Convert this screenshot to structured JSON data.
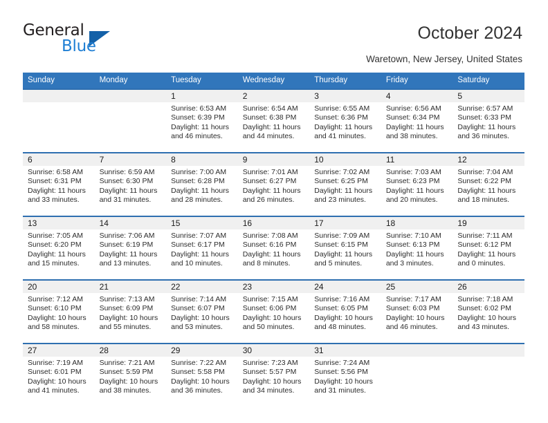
{
  "brand": {
    "name_part1": "General",
    "name_part2": "Blue",
    "accent_color": "#1f7fd4",
    "triangle_color": "#1461a8",
    "logo_icon": "triangle-logo-icon"
  },
  "header": {
    "title": "October 2024",
    "subtitle": "Waretown, New Jersey, United States"
  },
  "calendar": {
    "header_color": "#3176bb",
    "band_color": "#f0f0f0",
    "separator_color": "#2e6fb0",
    "weekday_headers": [
      "Sunday",
      "Monday",
      "Tuesday",
      "Wednesday",
      "Thursday",
      "Friday",
      "Saturday"
    ],
    "weeks": [
      [
        {
          "day": "",
          "sunrise": "",
          "sunset": "",
          "daylight_line1": "",
          "daylight_line2": ""
        },
        {
          "day": "",
          "sunrise": "",
          "sunset": "",
          "daylight_line1": "",
          "daylight_line2": ""
        },
        {
          "day": "1",
          "sunrise": "Sunrise: 6:53 AM",
          "sunset": "Sunset: 6:39 PM",
          "daylight_line1": "Daylight: 11 hours",
          "daylight_line2": "and 46 minutes."
        },
        {
          "day": "2",
          "sunrise": "Sunrise: 6:54 AM",
          "sunset": "Sunset: 6:38 PM",
          "daylight_line1": "Daylight: 11 hours",
          "daylight_line2": "and 44 minutes."
        },
        {
          "day": "3",
          "sunrise": "Sunrise: 6:55 AM",
          "sunset": "Sunset: 6:36 PM",
          "daylight_line1": "Daylight: 11 hours",
          "daylight_line2": "and 41 minutes."
        },
        {
          "day": "4",
          "sunrise": "Sunrise: 6:56 AM",
          "sunset": "Sunset: 6:34 PM",
          "daylight_line1": "Daylight: 11 hours",
          "daylight_line2": "and 38 minutes."
        },
        {
          "day": "5",
          "sunrise": "Sunrise: 6:57 AM",
          "sunset": "Sunset: 6:33 PM",
          "daylight_line1": "Daylight: 11 hours",
          "daylight_line2": "and 36 minutes."
        }
      ],
      [
        {
          "day": "6",
          "sunrise": "Sunrise: 6:58 AM",
          "sunset": "Sunset: 6:31 PM",
          "daylight_line1": "Daylight: 11 hours",
          "daylight_line2": "and 33 minutes."
        },
        {
          "day": "7",
          "sunrise": "Sunrise: 6:59 AM",
          "sunset": "Sunset: 6:30 PM",
          "daylight_line1": "Daylight: 11 hours",
          "daylight_line2": "and 31 minutes."
        },
        {
          "day": "8",
          "sunrise": "Sunrise: 7:00 AM",
          "sunset": "Sunset: 6:28 PM",
          "daylight_line1": "Daylight: 11 hours",
          "daylight_line2": "and 28 minutes."
        },
        {
          "day": "9",
          "sunrise": "Sunrise: 7:01 AM",
          "sunset": "Sunset: 6:27 PM",
          "daylight_line1": "Daylight: 11 hours",
          "daylight_line2": "and 26 minutes."
        },
        {
          "day": "10",
          "sunrise": "Sunrise: 7:02 AM",
          "sunset": "Sunset: 6:25 PM",
          "daylight_line1": "Daylight: 11 hours",
          "daylight_line2": "and 23 minutes."
        },
        {
          "day": "11",
          "sunrise": "Sunrise: 7:03 AM",
          "sunset": "Sunset: 6:23 PM",
          "daylight_line1": "Daylight: 11 hours",
          "daylight_line2": "and 20 minutes."
        },
        {
          "day": "12",
          "sunrise": "Sunrise: 7:04 AM",
          "sunset": "Sunset: 6:22 PM",
          "daylight_line1": "Daylight: 11 hours",
          "daylight_line2": "and 18 minutes."
        }
      ],
      [
        {
          "day": "13",
          "sunrise": "Sunrise: 7:05 AM",
          "sunset": "Sunset: 6:20 PM",
          "daylight_line1": "Daylight: 11 hours",
          "daylight_line2": "and 15 minutes."
        },
        {
          "day": "14",
          "sunrise": "Sunrise: 7:06 AM",
          "sunset": "Sunset: 6:19 PM",
          "daylight_line1": "Daylight: 11 hours",
          "daylight_line2": "and 13 minutes."
        },
        {
          "day": "15",
          "sunrise": "Sunrise: 7:07 AM",
          "sunset": "Sunset: 6:17 PM",
          "daylight_line1": "Daylight: 11 hours",
          "daylight_line2": "and 10 minutes."
        },
        {
          "day": "16",
          "sunrise": "Sunrise: 7:08 AM",
          "sunset": "Sunset: 6:16 PM",
          "daylight_line1": "Daylight: 11 hours",
          "daylight_line2": "and 8 minutes."
        },
        {
          "day": "17",
          "sunrise": "Sunrise: 7:09 AM",
          "sunset": "Sunset: 6:15 PM",
          "daylight_line1": "Daylight: 11 hours",
          "daylight_line2": "and 5 minutes."
        },
        {
          "day": "18",
          "sunrise": "Sunrise: 7:10 AM",
          "sunset": "Sunset: 6:13 PM",
          "daylight_line1": "Daylight: 11 hours",
          "daylight_line2": "and 3 minutes."
        },
        {
          "day": "19",
          "sunrise": "Sunrise: 7:11 AM",
          "sunset": "Sunset: 6:12 PM",
          "daylight_line1": "Daylight: 11 hours",
          "daylight_line2": "and 0 minutes."
        }
      ],
      [
        {
          "day": "20",
          "sunrise": "Sunrise: 7:12 AM",
          "sunset": "Sunset: 6:10 PM",
          "daylight_line1": "Daylight: 10 hours",
          "daylight_line2": "and 58 minutes."
        },
        {
          "day": "21",
          "sunrise": "Sunrise: 7:13 AM",
          "sunset": "Sunset: 6:09 PM",
          "daylight_line1": "Daylight: 10 hours",
          "daylight_line2": "and 55 minutes."
        },
        {
          "day": "22",
          "sunrise": "Sunrise: 7:14 AM",
          "sunset": "Sunset: 6:07 PM",
          "daylight_line1": "Daylight: 10 hours",
          "daylight_line2": "and 53 minutes."
        },
        {
          "day": "23",
          "sunrise": "Sunrise: 7:15 AM",
          "sunset": "Sunset: 6:06 PM",
          "daylight_line1": "Daylight: 10 hours",
          "daylight_line2": "and 50 minutes."
        },
        {
          "day": "24",
          "sunrise": "Sunrise: 7:16 AM",
          "sunset": "Sunset: 6:05 PM",
          "daylight_line1": "Daylight: 10 hours",
          "daylight_line2": "and 48 minutes."
        },
        {
          "day": "25",
          "sunrise": "Sunrise: 7:17 AM",
          "sunset": "Sunset: 6:03 PM",
          "daylight_line1": "Daylight: 10 hours",
          "daylight_line2": "and 46 minutes."
        },
        {
          "day": "26",
          "sunrise": "Sunrise: 7:18 AM",
          "sunset": "Sunset: 6:02 PM",
          "daylight_line1": "Daylight: 10 hours",
          "daylight_line2": "and 43 minutes."
        }
      ],
      [
        {
          "day": "27",
          "sunrise": "Sunrise: 7:19 AM",
          "sunset": "Sunset: 6:01 PM",
          "daylight_line1": "Daylight: 10 hours",
          "daylight_line2": "and 41 minutes."
        },
        {
          "day": "28",
          "sunrise": "Sunrise: 7:21 AM",
          "sunset": "Sunset: 5:59 PM",
          "daylight_line1": "Daylight: 10 hours",
          "daylight_line2": "and 38 minutes."
        },
        {
          "day": "29",
          "sunrise": "Sunrise: 7:22 AM",
          "sunset": "Sunset: 5:58 PM",
          "daylight_line1": "Daylight: 10 hours",
          "daylight_line2": "and 36 minutes."
        },
        {
          "day": "30",
          "sunrise": "Sunrise: 7:23 AM",
          "sunset": "Sunset: 5:57 PM",
          "daylight_line1": "Daylight: 10 hours",
          "daylight_line2": "and 34 minutes."
        },
        {
          "day": "31",
          "sunrise": "Sunrise: 7:24 AM",
          "sunset": "Sunset: 5:56 PM",
          "daylight_line1": "Daylight: 10 hours",
          "daylight_line2": "and 31 minutes."
        },
        {
          "day": "",
          "sunrise": "",
          "sunset": "",
          "daylight_line1": "",
          "daylight_line2": ""
        },
        {
          "day": "",
          "sunrise": "",
          "sunset": "",
          "daylight_line1": "",
          "daylight_line2": ""
        }
      ]
    ]
  }
}
